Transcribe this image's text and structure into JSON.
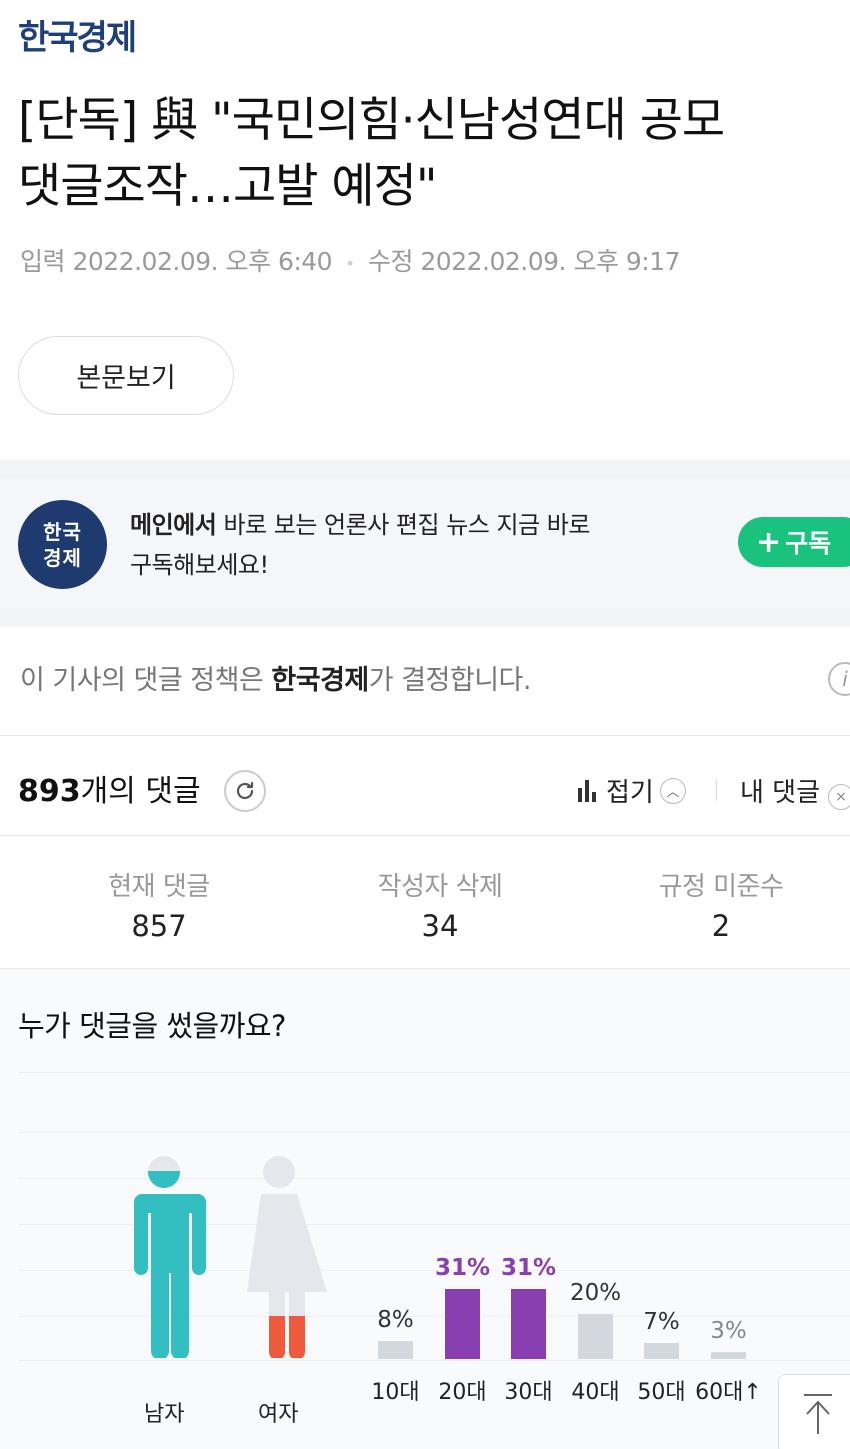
{
  "header": {
    "logo": "한국경제"
  },
  "article": {
    "headline_line1": "[단독] 與 \"국민의힘·신남성연대 공모",
    "headline_line2": "댓글조작…고발 예정\"",
    "input_label": "입력",
    "input_date": "2022.02.09. 오후 6:40",
    "modified_label": "수정",
    "modified_date": "2022.02.09. 오후 9:17",
    "body_button": "본문보기"
  },
  "subscribe": {
    "badge_line1": "한국",
    "badge_line2": "경제",
    "text_bold": "메인에서",
    "text_rest": " 바로 보는 언론사 편집 뉴스 지금 바로",
    "text_line2": "구독해보세요!",
    "button_label": "구독"
  },
  "policy": {
    "prefix": "이 기사의 댓글 정책은 ",
    "press": "한국경제",
    "suffix": "가 결정합니다."
  },
  "comments": {
    "count": "893",
    "count_suffix": "개의 댓글",
    "fold_label": "접기",
    "mine_label": "내 댓글",
    "stats": [
      {
        "label": "현재 댓글",
        "value": "857"
      },
      {
        "label": "작성자 삭제",
        "value": "34"
      },
      {
        "label": "규정 미준수",
        "value": "2"
      }
    ]
  },
  "demographics": {
    "title": "누가 댓글을 썼을까요?",
    "gender": {
      "male_label": "남자",
      "female_label": "여자",
      "male_share": 0.91,
      "female_share": 0.09
    },
    "colors": {
      "male": "#33bec2",
      "female": "#f05a3c",
      "highlight": "#8a3fb0",
      "normal_bar": "#d3d8de",
      "normal_text": "#333333"
    }
  },
  "chart_data": {
    "type": "bar",
    "categories": [
      "10대",
      "20대",
      "30대",
      "40대",
      "50대",
      "60대↑"
    ],
    "values": [
      8,
      31,
      31,
      20,
      7,
      3
    ],
    "value_labels": [
      "8%",
      "31%",
      "31%",
      "20%",
      "7%",
      "3%"
    ],
    "highlighted": [
      false,
      true,
      true,
      false,
      false,
      false
    ],
    "ylim": [
      0,
      31
    ]
  }
}
